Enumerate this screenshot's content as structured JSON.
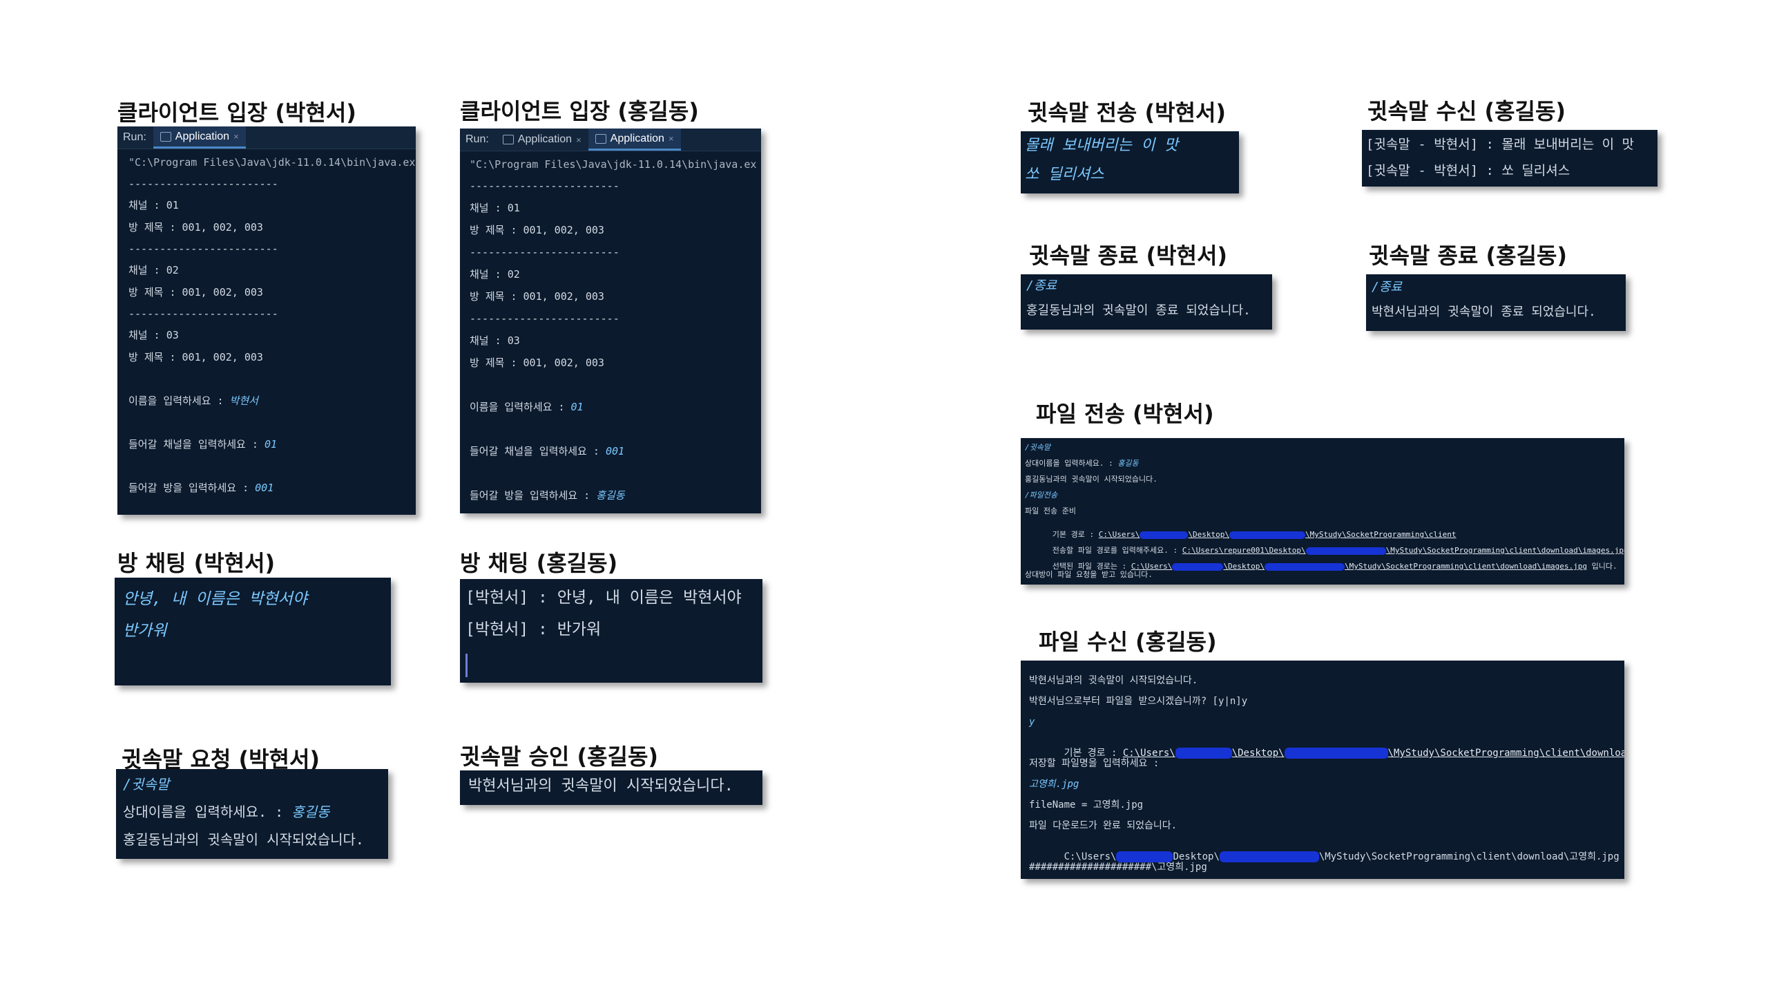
{
  "run_label": "Run:",
  "app_tab": "Application",
  "sections": {
    "enter_park": {
      "title": "클라이언트 입장 (박현서)",
      "lines": [
        "\"C:\\Program Files\\Java\\jdk-11.0.14\\bin\\java.ex",
        "------------------------",
        "채널 : 01",
        "방 제목 : 001, 002, 003",
        "------------------------",
        "채널 : 02",
        "방 제목 : 001, 002, 003",
        "------------------------",
        "채널 : 03",
        "방 제목 : 001, 002, 003"
      ],
      "name_prompt": "이름을 입력하세요 : ",
      "name_value": "박현서",
      "channel_prompt": "들어갈 채널을 입력하세요 : ",
      "channel_value": "01",
      "room_prompt": "들어갈 방을 입력하세요 : ",
      "room_value": "001"
    },
    "enter_hong": {
      "title": "클라이언트 입장 (홍길동)",
      "lines": [
        "\"C:\\Program Files\\Java\\jdk-11.0.14\\bin\\java.ex",
        "------------------------",
        "채널 : 01",
        "방 제목 : 001, 002, 003",
        "------------------------",
        "채널 : 02",
        "방 제목 : 001, 002, 003",
        "------------------------",
        "채널 : 03",
        "방 제목 : 001, 002, 003"
      ],
      "name_prompt": "이름을 입력하세요 : ",
      "name_value": "01",
      "channel_prompt": "들어갈 채널을 입력하세요 : ",
      "channel_value": "001",
      "room_prompt": "들어갈 방을 입력하세요 : ",
      "room_value": "홍길동"
    },
    "chat_park": {
      "title": "방 채팅 (박현서)",
      "line1": "안녕, 내 이름은 박현서야",
      "line2": "반가워"
    },
    "chat_hong": {
      "title": "방 채팅 (홍길동)",
      "line1": "[박현서] : 안녕, 내 이름은 박현서야",
      "line2": "[박현서] : 반가워"
    },
    "whisper_req_park": {
      "title": "귓속말 요청 (박현서)",
      "cmd": "/귓속말",
      "prompt": "상대이름을 입력하세요. : ",
      "prompt_value": "홍길동",
      "result": "홍길동님과의 귓속말이 시작되었습니다."
    },
    "whisper_ok_hong": {
      "title": "귓속말 승인 (홍길동)",
      "result": "박현서님과의 귓속말이 시작되었습니다."
    },
    "whisper_send_park": {
      "title": "귓속말 전송 (박현서)",
      "line1": "몰래 보내버리는 이 맛",
      "line2": "쏘 딜리셔스"
    },
    "whisper_recv_hong": {
      "title": "귓속말 수신 (홍길동)",
      "line1": "[귓속말 - 박현서] : 몰래 보내버리는 이 맛",
      "line2": "[귓속말 - 박현서] : 쏘 딜리셔스"
    },
    "whisper_end_park": {
      "title": "귓속말 종료 (박현서)",
      "cmd": "/종료",
      "result": "홍길동님과의 귓속말이 종료 되었습니다."
    },
    "whisper_end_hong": {
      "title": "귓속말 종료 (홍길동)",
      "cmd": "/종료",
      "result": "박현서님과의 귓속말이 종료 되었습니다."
    },
    "file_send_park": {
      "title": "파일 전송 (박현서)",
      "l1": "/귓속말",
      "l2_prompt": "상대이름을 입력하세요. : ",
      "l2_value": "홍길동",
      "l3": "홍길동님과의 귓속말이 시작되었습니다.",
      "l4": "/파일전송",
      "l5": "파일 전송 준비",
      "l6_label": "기본 경로 : ",
      "l6_a": "C:\\Users\\",
      "l6_b": "\\Desktop\\",
      "l6_c": "\\MyStudy\\SocketProgramming\\client",
      "l7_label": "전송할 파일 경로를 입력해주세요. : ",
      "l7_a": "C:\\Users\\repure001\\Desktop\\",
      "l7_b": "\\MyStudy\\SocketProgramming\\client\\download\\images.jpg",
      "l8_label": "선택된 파일 경로는 : ",
      "l8_a": "C:\\Users\\",
      "l8_b": "\\Desktop\\",
      "l8_c": "\\MyStudy\\SocketProgramming\\client\\download\\images.jpg",
      "l8_tail": " 입니다.",
      "l9": "상대방이 파일 요청을 받고 있습니다."
    },
    "file_recv_hong": {
      "title": "파일 수신 (홍길동)",
      "l1": "박현서님과의 귓속말이 시작되었습니다.",
      "l2": "박현서님으로부터 파일을 받으시겠습니까? [y|n]y",
      "l3": "y",
      "l4_label": "기본 경로 : ",
      "l4_a": "C:\\Users\\",
      "l4_b": "\\Desktop\\",
      "l4_c": "\\MyStudy\\SocketProgramming\\client\\download",
      "l5": "저장할 파일명을 입력하세요 :",
      "l6": "고영희.jpg",
      "l7": "fileName = 고영희.jpg",
      "l8": "파일 다운로드가 완료 되었습니다.",
      "l9_a": "C:\\Users\\",
      "l9_b": "Desktop\\",
      "l9_c": "\\MyStudy\\SocketProgramming\\client\\download\\고영희.jpg",
      "l10": "#####################\\고영희.jpg"
    }
  },
  "colors": {
    "terminal_bg": "#0b1a2d",
    "text": "#d3dbe5",
    "input_italic": "#7cc9ff",
    "redaction": "#1633d6",
    "tab_active": "#1d3556"
  }
}
